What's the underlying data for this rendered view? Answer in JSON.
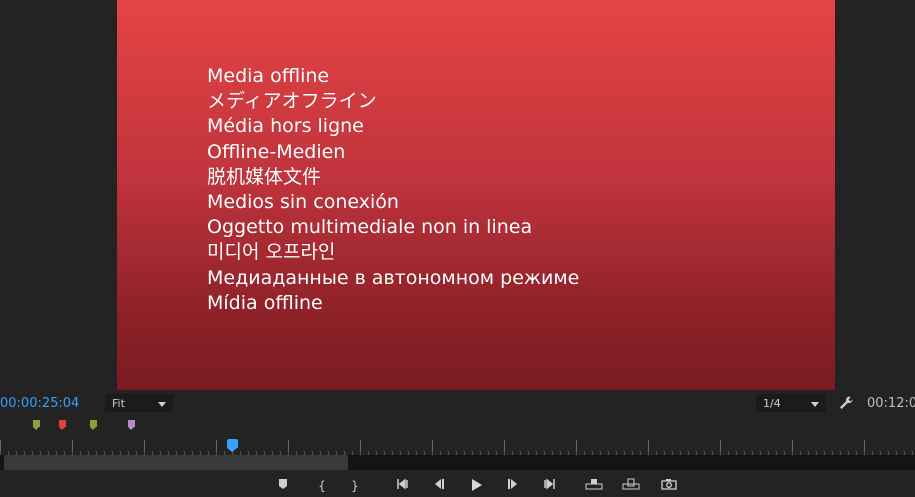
{
  "viewer": {
    "offline_messages": [
      "Media offline",
      "メディアオフライン",
      "Média hors ligne",
      "Offline-Medien",
      "脱机媒体文件",
      "Medios sin conexión",
      "Oggetto multimediale non in linea",
      "미디어 오프라인",
      "Медиаданные в автономном режиме",
      "Mídia offline"
    ],
    "background_top": "#e44444",
    "background_bottom": "#7a1b22"
  },
  "toolbar": {
    "current_timecode": "00:00:25:04",
    "duration_timecode": "00:12:0",
    "zoom_select": "Fit",
    "resolution_select": "1/4",
    "timecode_color": "#3aa0ff"
  },
  "markers": [
    {
      "color": "#8aa03a"
    },
    {
      "color": "#e04040"
    },
    {
      "color": "#8aa03a"
    },
    {
      "color": "#b58ad0"
    }
  ],
  "playhead_progress": 0.254,
  "transport": {
    "add_marker": "marker-icon",
    "mark_in": "{",
    "mark_out": "}",
    "go_to_in": "go-to-in-icon",
    "step_back": "step-back-icon",
    "play": "play-icon",
    "step_forward": "step-forward-icon",
    "go_to_out": "go-to-out-icon",
    "insert": "insert-icon",
    "overwrite": "overwrite-icon",
    "export_frame": "camera-icon"
  }
}
